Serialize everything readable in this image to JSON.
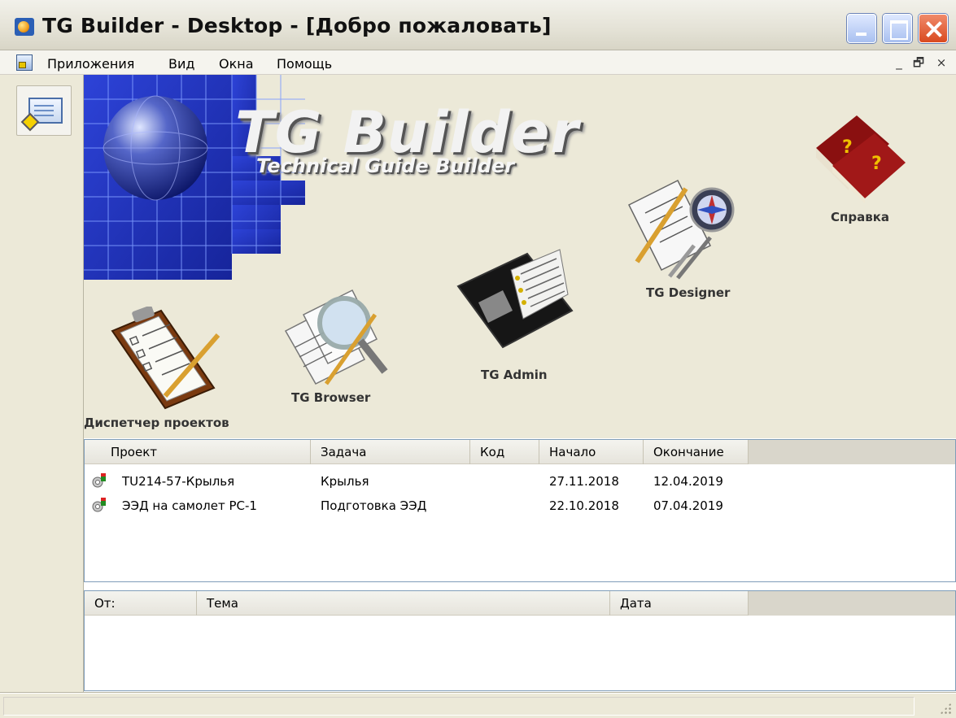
{
  "window": {
    "title": "TG Builder - Desktop - [Добро пожаловать]",
    "icon": "tg-builder-app-icon"
  },
  "menu": {
    "items": [
      "Приложения",
      "Вид",
      "Окна",
      "Помощь"
    ],
    "mdi_controls": [
      "_",
      "🗗",
      "×"
    ]
  },
  "banner": {
    "title": "TG Builder",
    "subtitle": "Technical Guide Builder"
  },
  "apps": [
    {
      "label": "Диспетчер проектов",
      "icon": "clipboard-pencil-icon"
    },
    {
      "label": "TG Browser",
      "icon": "magnifier-documents-icon"
    },
    {
      "label": "TG Admin",
      "icon": "binder-notebook-icon"
    },
    {
      "label": "TG Designer",
      "icon": "compass-drawing-icon"
    },
    {
      "label": "Справка",
      "icon": "help-books-icon"
    }
  ],
  "projects": {
    "columns": [
      "Проект",
      "Задача",
      "Код",
      "Начало",
      "Окончание"
    ],
    "rows": [
      {
        "project": "TU214-57-Крылья",
        "task": "Крылья",
        "code": "",
        "start": "27.11.2018",
        "end": "12.04.2019"
      },
      {
        "project": "ЭЭД на самолет РС-1",
        "task": "Подготовка ЭЭД",
        "code": "",
        "start": "22.10.2018",
        "end": "07.04.2019"
      }
    ]
  },
  "messages": {
    "columns": [
      "От:",
      "Тема",
      "Дата"
    ]
  },
  "colors": {
    "window_bg": "#ece9d8",
    "banner_blue": "#1c2fb0",
    "table_border": "#7f9db9"
  }
}
